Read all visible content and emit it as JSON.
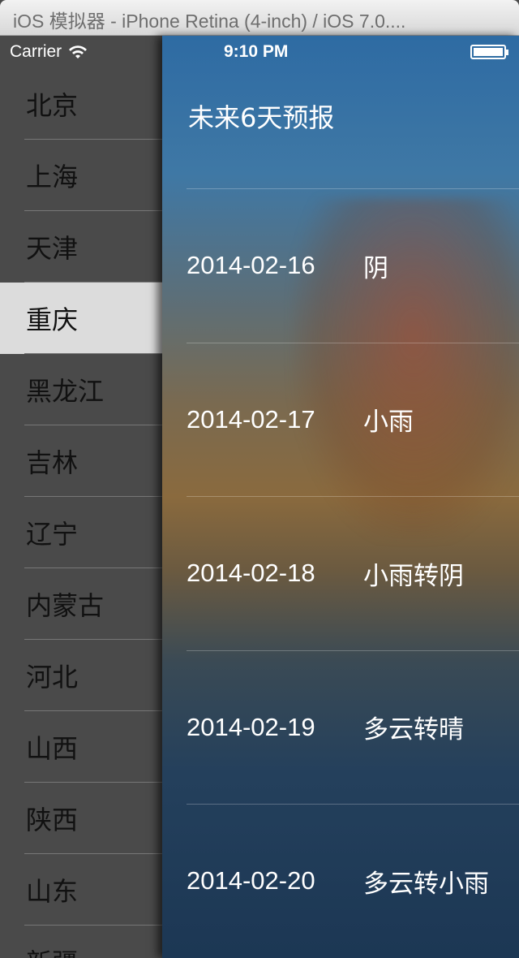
{
  "window": {
    "title": "iOS 模拟器 - iPhone Retina (4-inch) / iOS 7.0...."
  },
  "status": {
    "carrier": "Carrier",
    "time": "9:10 PM"
  },
  "sidebar": {
    "items": [
      "北京",
      "上海",
      "天津",
      "重庆",
      "黑龙江",
      "吉林",
      "辽宁",
      "内蒙古",
      "河北",
      "山西",
      "陕西",
      "山东",
      "新疆"
    ],
    "selected": "重庆"
  },
  "forecast": {
    "title": "未来6天预报",
    "rows": [
      {
        "date": "2014-02-16",
        "weather": "阴"
      },
      {
        "date": "2014-02-17",
        "weather": "小雨"
      },
      {
        "date": "2014-02-18",
        "weather": "小雨转阴"
      },
      {
        "date": "2014-02-19",
        "weather": "多云转晴"
      },
      {
        "date": "2014-02-20",
        "weather": "多云转小雨"
      }
    ]
  }
}
